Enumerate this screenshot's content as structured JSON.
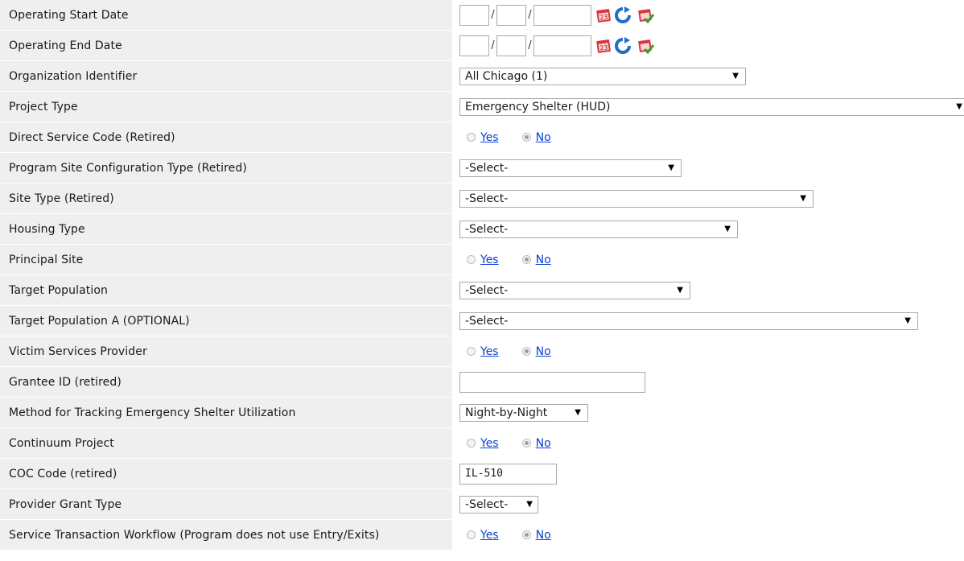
{
  "rows": [
    {
      "label": "Operating Start Date",
      "type": "date",
      "month": "",
      "day": "",
      "year": ""
    },
    {
      "label": "Operating End Date",
      "type": "date",
      "month": "",
      "day": "",
      "year": ""
    },
    {
      "label": "Organization Identifier",
      "type": "select",
      "value": "All Chicago (1)"
    },
    {
      "label": "Project Type",
      "type": "select",
      "value": "Emergency Shelter (HUD)"
    },
    {
      "label": "Direct Service Code (Retired)",
      "type": "radio",
      "yes": "Yes",
      "no": "No",
      "selected": "No"
    },
    {
      "label": "Program Site Configuration Type (Retired)",
      "type": "select",
      "value": "-Select-"
    },
    {
      "label": "Site Type (Retired)",
      "type": "select",
      "value": "-Select-"
    },
    {
      "label": "Housing Type",
      "type": "select",
      "value": "-Select-"
    },
    {
      "label": "Principal Site",
      "type": "radio",
      "yes": "Yes",
      "no": "No",
      "selected": "No"
    },
    {
      "label": "Target Population",
      "type": "select",
      "value": "-Select-"
    },
    {
      "label": "Target Population A (OPTIONAL)",
      "type": "select",
      "value": "-Select-"
    },
    {
      "label": "Victim Services Provider",
      "type": "radio",
      "yes": "Yes",
      "no": "No",
      "selected": "No"
    },
    {
      "label": "Grantee ID (retired)",
      "type": "text",
      "value": ""
    },
    {
      "label": "Method for Tracking Emergency Shelter Utilization",
      "type": "select",
      "value": "Night-by-Night"
    },
    {
      "label": "Continuum Project",
      "type": "radio",
      "yes": "Yes",
      "no": "No",
      "selected": "No"
    },
    {
      "label": "COC Code (retired)",
      "type": "text",
      "value": "IL-510"
    },
    {
      "label": "Provider Grant Type",
      "type": "select",
      "value": "-Select-"
    },
    {
      "label": "Service Transaction Workflow (Program does not use Entry/Exits)",
      "type": "radio",
      "yes": "Yes",
      "no": "No",
      "selected": "No"
    }
  ],
  "icons": {
    "calendar": "calendar-icon",
    "refresh": "refresh-icon",
    "calendar_check": "calendar-today-icon"
  },
  "colors": {
    "label_bg": "#efefef",
    "link": "#0b3fd6",
    "calendar_red": "#d9363b",
    "refresh_blue": "#1f6fc8"
  }
}
